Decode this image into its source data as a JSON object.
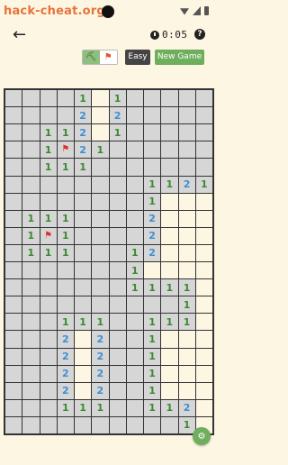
{
  "watermark": "hack-cheat.org",
  "header": {
    "back_icon": "arrow-left-icon",
    "timer": "0:05",
    "help": "?"
  },
  "controls": {
    "mode_dig_icon": "pickaxe-icon",
    "mode_flag_icon": "flag-icon",
    "difficulty": "Easy",
    "new_game": "New Game"
  },
  "colors": {
    "num1": "#3a8a2e",
    "num2": "#3b8fd4",
    "flag": "#e0302a",
    "hidden": "#d6d6d6",
    "revealed": "#fdf6e3",
    "accent": "#6fae5c"
  },
  "board": {
    "cols": 12,
    "rows": [
      "....1R1.....",
      "....2R2.....",
      "..112R1.....",
      "..1F21......",
      "..111.......",
      "........1121",
      "........1RRR",
      ".111....2RRR",
      ".1F1....2RRR",
      ".111...12RRR",
      ".......1RRRR",
      ".......1111R",
      "..........1R",
      "...111..111R",
      "...2R2..1RRR",
      "...2R2..1RRR",
      "...2R2..1RRR",
      "...2R2..1RRR",
      "...111..112R",
      "..........1R"
    ]
  }
}
